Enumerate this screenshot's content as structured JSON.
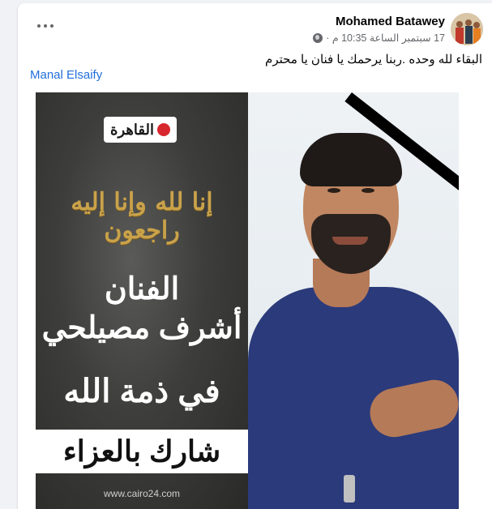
{
  "post": {
    "author": "Mohamed Batawey",
    "timestamp": "17 سبتمبر الساعة 10:35 م ·",
    "text": "البقاء لله وحده .ربنا يرحمك يا فنان يا محترم",
    "tagged": "Manal Elsaify",
    "more_icon": "more-horizontal-icon",
    "privacy_icon": "globe-icon"
  },
  "image": {
    "logo_text": "القاهرة",
    "verse": "إنا لله وإنا إليه راجعون",
    "label": "الفنان",
    "name": "أشرف مصيلحي",
    "rip": "في ذمة الله",
    "condolence": "شارك بالعزاء",
    "site": "www.cairo24.com"
  }
}
